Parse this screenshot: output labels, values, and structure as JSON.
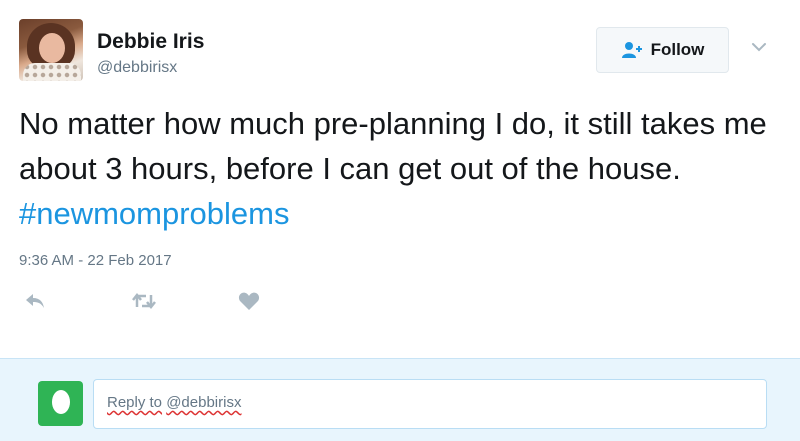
{
  "user": {
    "name": "Debbie Iris",
    "handle": "@debbirisx"
  },
  "follow_button": {
    "label": "Follow",
    "icon": "add-user-icon"
  },
  "menu": {
    "icon": "chevron-down-icon"
  },
  "tweet": {
    "text": "No matter how much pre-planning I do, it still takes me about 3 hours, before I can get out of the house. ",
    "hashtag": "#newmomproblems",
    "timestamp": "9:36 AM - 22 Feb 2017"
  },
  "actions": [
    {
      "name": "reply",
      "icon": "reply-icon"
    },
    {
      "name": "retweet",
      "icon": "retweet-icon"
    },
    {
      "name": "like",
      "icon": "heart-icon"
    }
  ],
  "reply_box": {
    "placeholder_prefix": "Reply to",
    "placeholder_handle": "@debbirisx"
  },
  "colors": {
    "hashtag": "#1b95e0",
    "secondary_text": "#657786",
    "icon_gray": "#aab8c2",
    "reply_bar_bg": "#e8f5fd",
    "reply_avatar": "#2fb455"
  }
}
